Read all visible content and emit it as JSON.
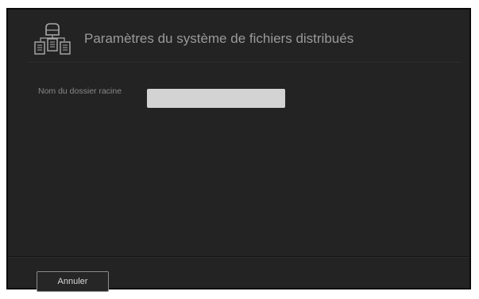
{
  "dialog": {
    "title": "Paramètres du système de fichiers distribués",
    "icon": "distributed-filesystem-icon"
  },
  "form": {
    "root_folder_label": "Nom du dossier racine",
    "root_folder_value": "",
    "root_folder_placeholder": ""
  },
  "footer": {
    "cancel_label": "Annuler"
  },
  "colors": {
    "dialog_background": "#232323",
    "title_text": "#9a9a9a",
    "input_background": "#d3d3d3",
    "button_border": "#8a8a8a"
  }
}
